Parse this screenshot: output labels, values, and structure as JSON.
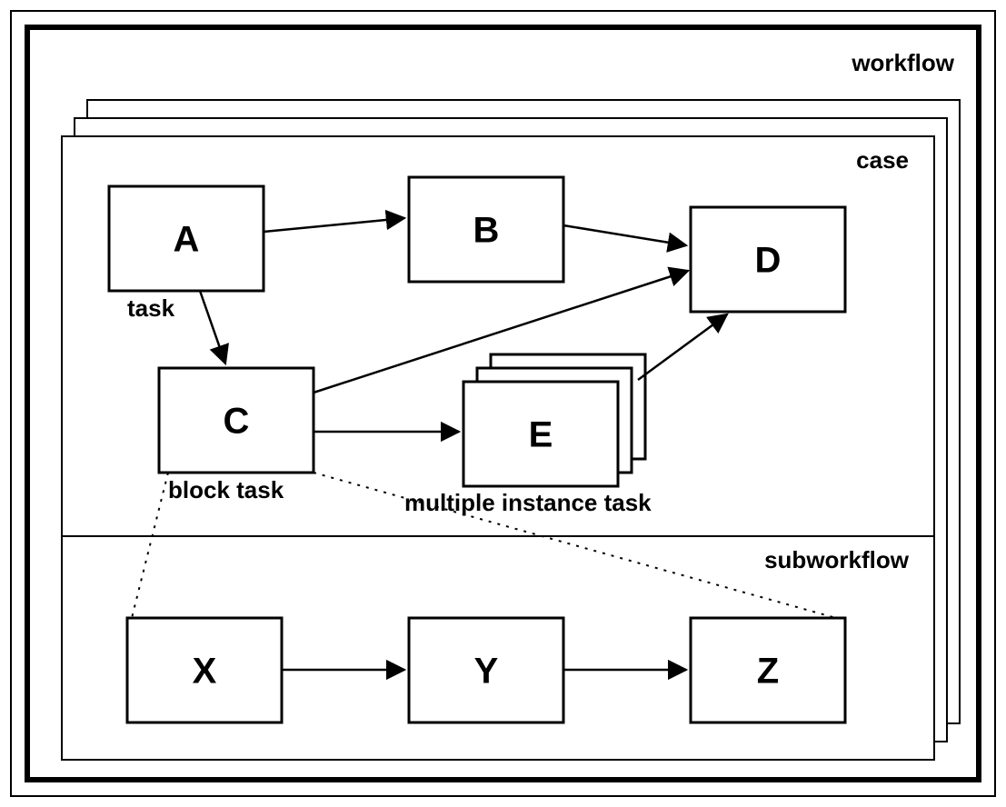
{
  "labels": {
    "workflow": "workflow",
    "case": "case",
    "subworkflow": "subworkflow",
    "task": "task",
    "block_task": "block task",
    "multi_instance_task": "multiple instance task"
  },
  "nodes": {
    "A": "A",
    "B": "B",
    "C": "C",
    "D": "D",
    "E": "E",
    "X": "X",
    "Y": "Y",
    "Z": "Z"
  },
  "diagram": {
    "edges_solid": [
      [
        "A",
        "B"
      ],
      [
        "A",
        "C"
      ],
      [
        "B",
        "D"
      ],
      [
        "C",
        "D"
      ],
      [
        "C",
        "E"
      ],
      [
        "E",
        "D"
      ],
      [
        "X",
        "Y"
      ],
      [
        "Y",
        "Z"
      ]
    ],
    "edges_dotted": [
      [
        "C",
        "X"
      ],
      [
        "C",
        "Z"
      ]
    ],
    "stacks": [
      "case",
      "E"
    ]
  }
}
